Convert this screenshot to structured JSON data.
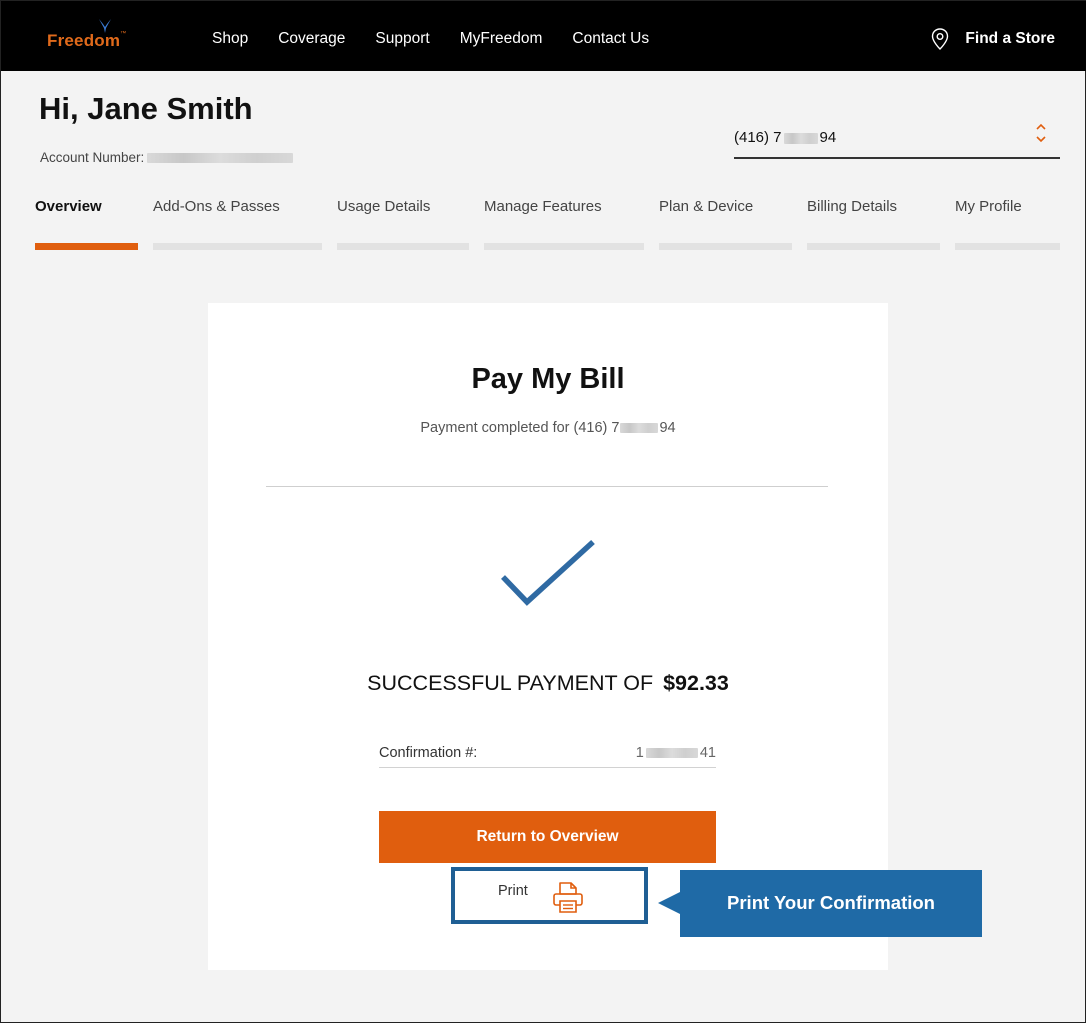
{
  "header": {
    "brand": "Freedom",
    "nav": [
      "Shop",
      "Coverage",
      "Support",
      "MyFreedom",
      "Contact Us"
    ],
    "store_label": "Find a Store",
    "store_icon": "location-pin-icon"
  },
  "account": {
    "greeting": "Hi, Jane Smith",
    "number_label": "Account Number:",
    "phone_prefix": "(416) 7",
    "phone_suffix": "94"
  },
  "tabs": [
    {
      "label": "Overview",
      "active": true
    },
    {
      "label": "Add-Ons & Passes",
      "active": false
    },
    {
      "label": "Usage Details",
      "active": false
    },
    {
      "label": "Manage Features",
      "active": false
    },
    {
      "label": "Plan & Device",
      "active": false
    },
    {
      "label": "Billing Details",
      "active": false
    },
    {
      "label": "My Profile",
      "active": false
    }
  ],
  "card": {
    "title": "Pay My Bill",
    "subtitle_prefix": "Payment completed for (416) 7",
    "subtitle_suffix": "94",
    "success_text": "SUCCESSFUL PAYMENT OF",
    "amount": "$92.33",
    "confirmation_label": "Confirmation #:",
    "confirmation_prefix": "1",
    "confirmation_suffix": "41",
    "return_button": "Return to Overview",
    "print_label": "Print"
  },
  "callout": {
    "text": "Print Your Confirmation"
  },
  "colors": {
    "brand_orange": "#e05e0e",
    "callout_blue": "#1f6aa6",
    "check_blue": "#2f6aa3"
  }
}
